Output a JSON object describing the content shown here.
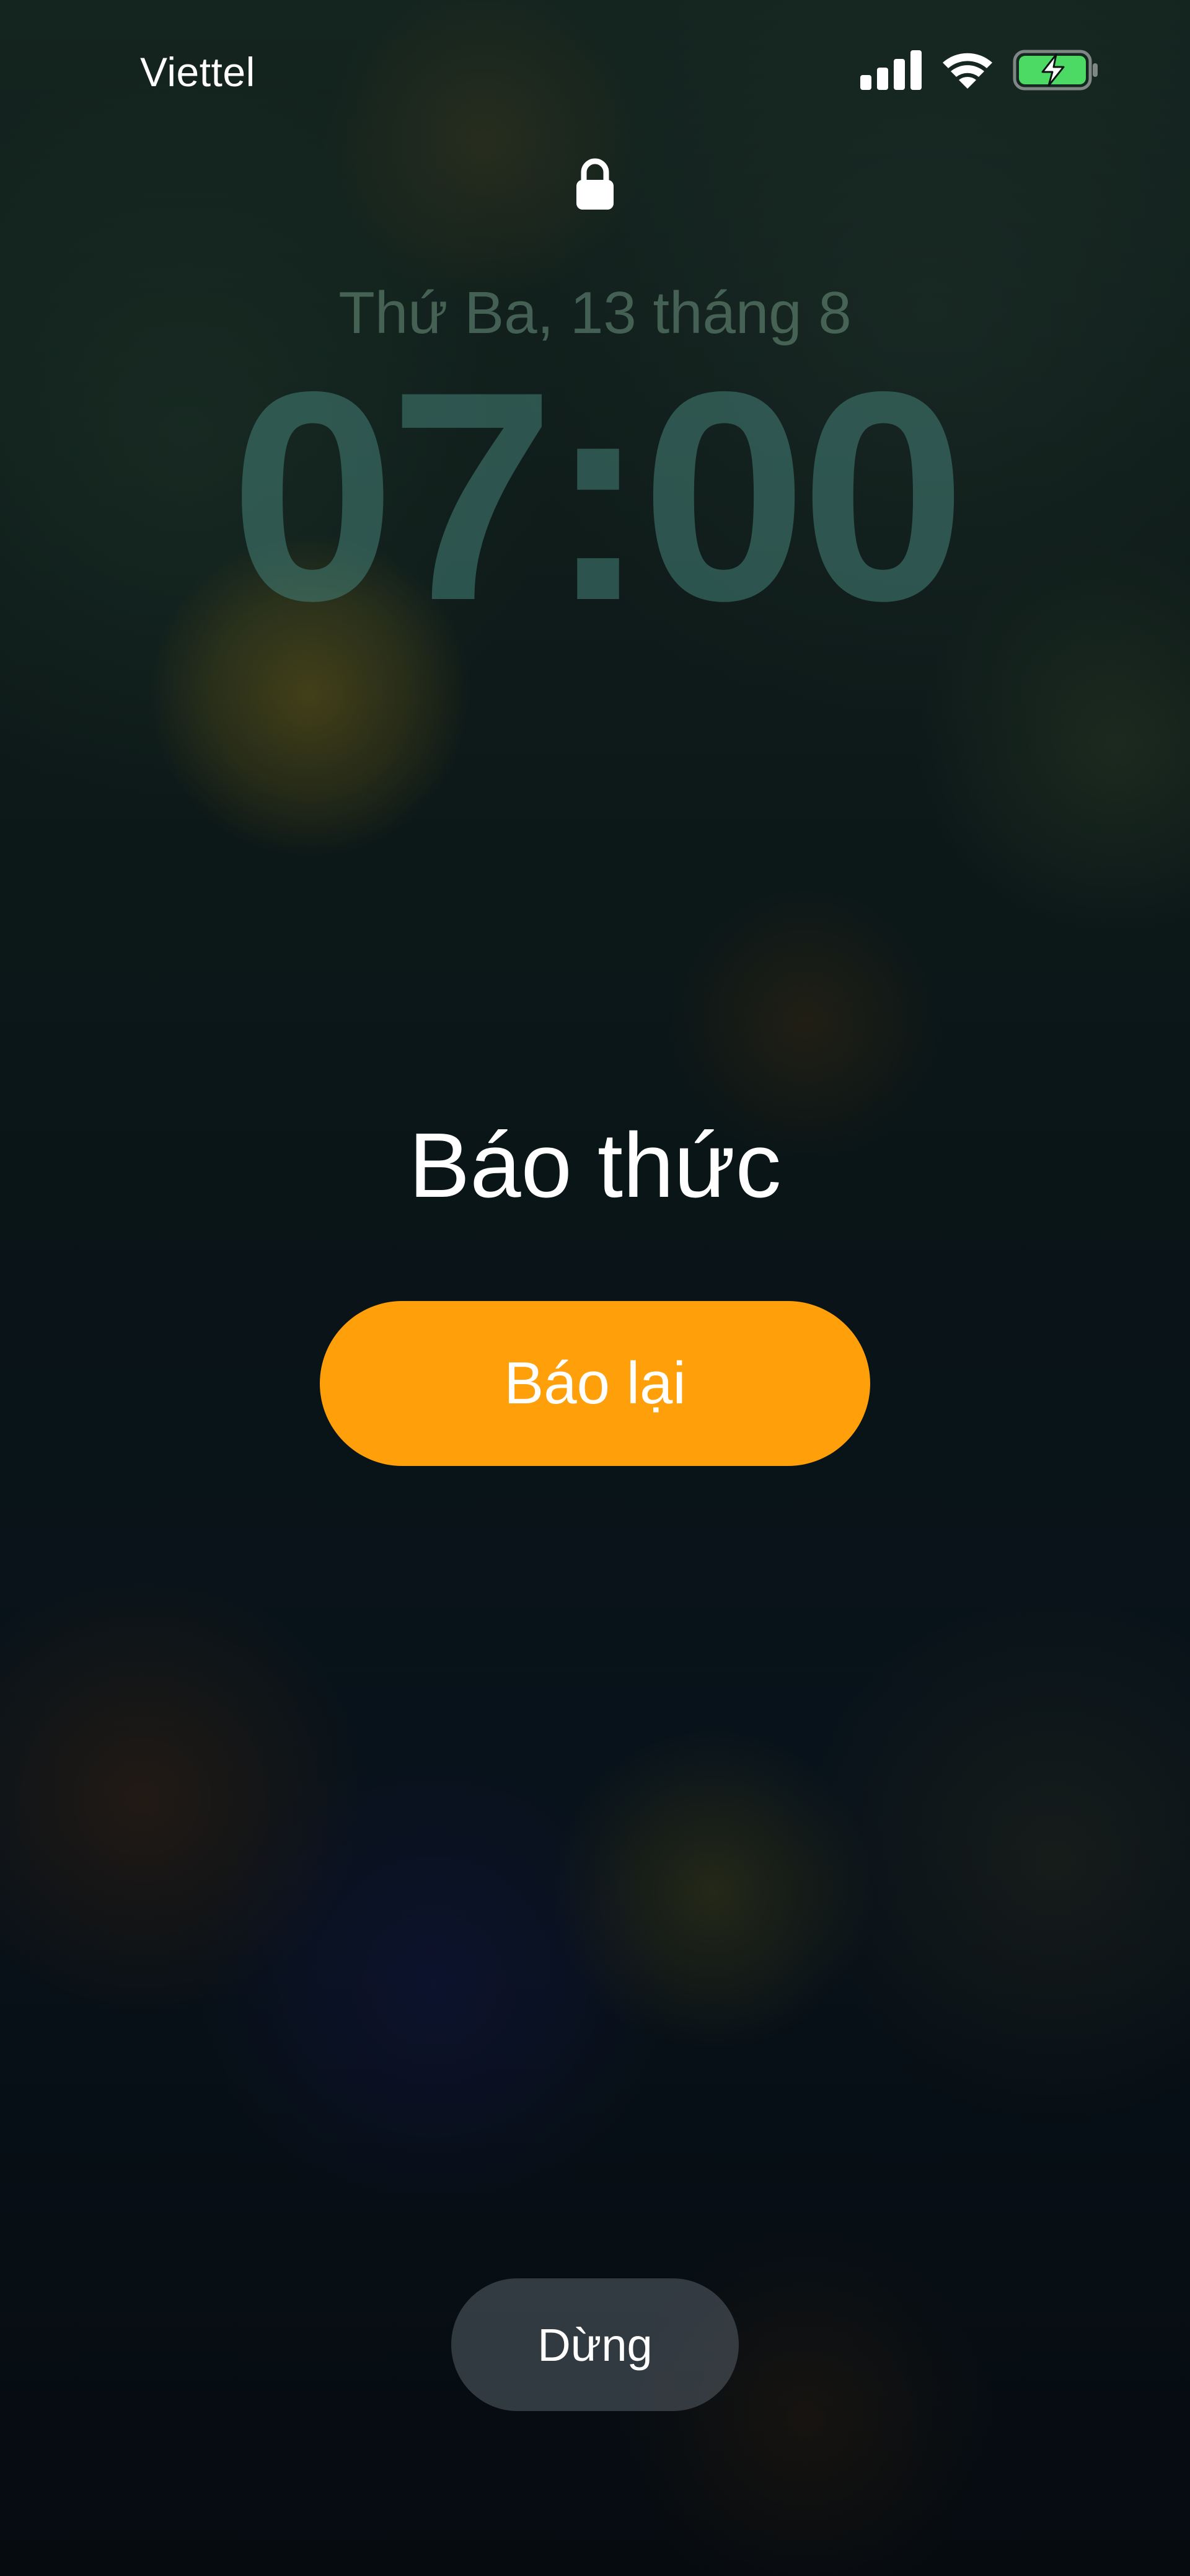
{
  "status_bar": {
    "carrier": "Viettel",
    "icons": [
      "cellular-signal-icon",
      "wifi-icon",
      "battery-charging-icon"
    ],
    "battery_color": "#4cd964"
  },
  "lock_screen": {
    "lock_icon": "lock-icon",
    "date": "Thứ Ba, 13 tháng 8",
    "time": "07:00"
  },
  "alarm": {
    "title": "Báo thức",
    "snooze_label": "Báo lại",
    "stop_label": "Dừng",
    "accent_color": "#ff9f0a"
  }
}
